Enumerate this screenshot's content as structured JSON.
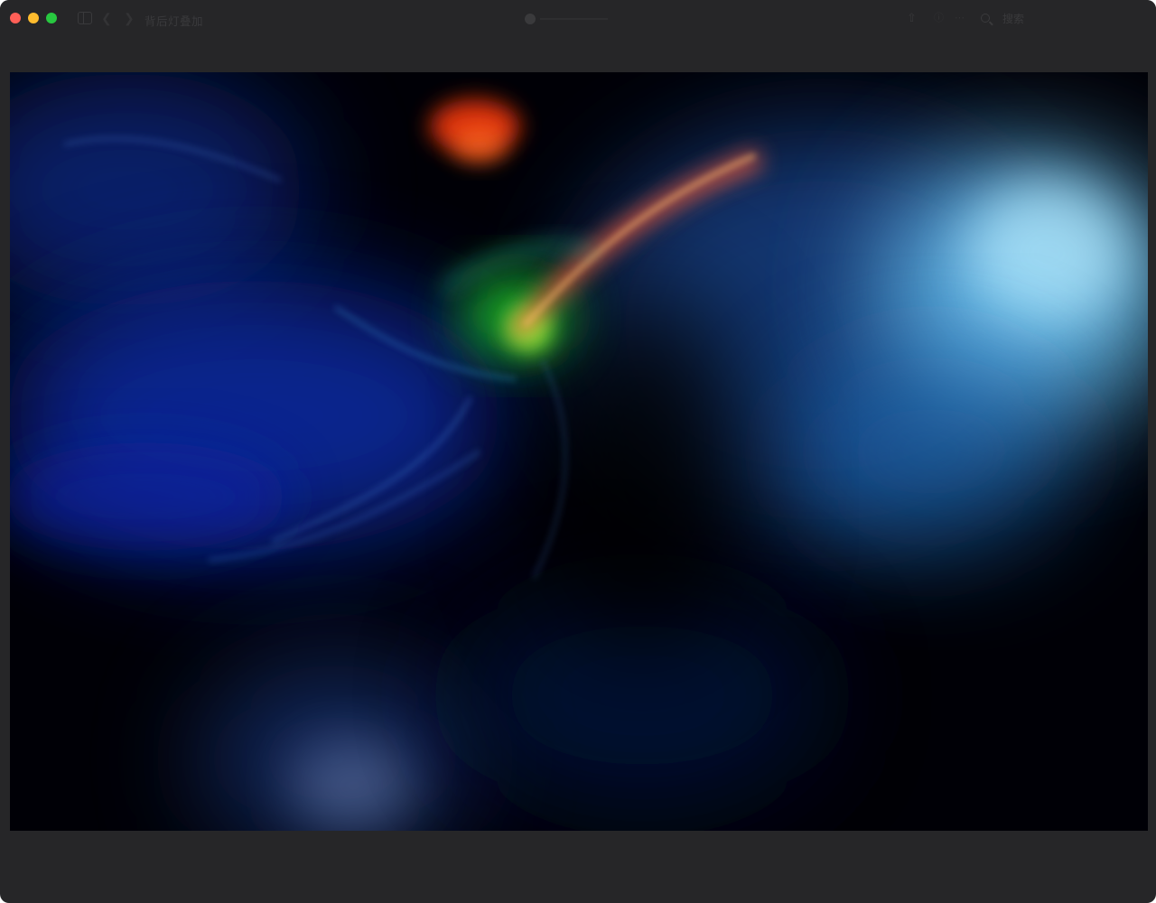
{
  "window": {
    "title": "背后灯叠加",
    "search_label": "搜索"
  },
  "colors": {
    "window_bg": "#262628",
    "canvas_bg": "#000006",
    "traffic_close": "#ff5f57",
    "traffic_minimize": "#febc2e",
    "traffic_maximize": "#28c840"
  },
  "icons": {
    "sidebar": "sidebar-icon",
    "back": "chevron-left-icon",
    "forward": "chevron-right-icon",
    "share": "share-icon",
    "info": "info-icon",
    "more": "more-icon",
    "search": "search-icon"
  }
}
